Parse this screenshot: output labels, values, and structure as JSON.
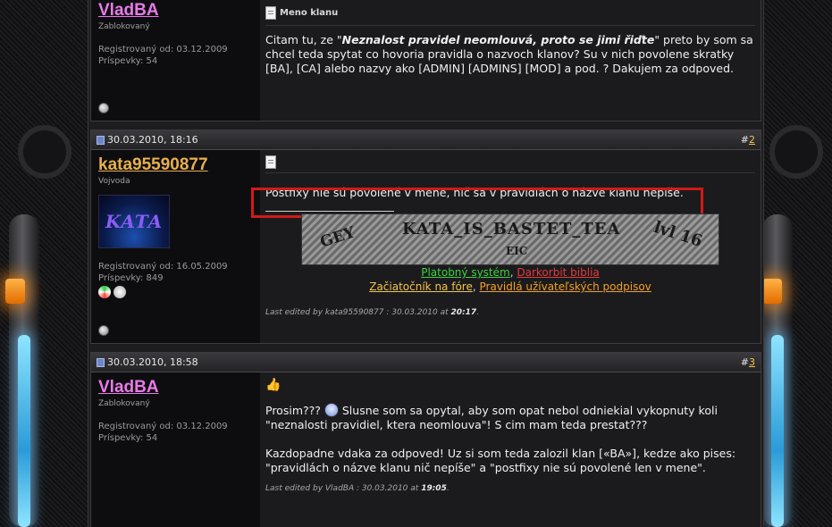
{
  "post1": {
    "username": "VladBA",
    "username_color": "#e87be8",
    "user_title": "Zablokovaný",
    "registered": "Registrovaný od: 03.12.2009",
    "posts": "Príspevky: 54",
    "msg_title": "Meno klanu",
    "text_before": "Citam tu, ze \"",
    "text_bold": "Neznalost pravidel neomlouvá, proto se jimi řiďte",
    "text_after": "\" preto by som sa chcel teda spytat co hovoria pravidla o nazvoch klanov? Su v nich povolene skratky [BA], [CA] alebo nazvy ako [ADMIN] [ADMINS] [MOD] a pod. ? Dakujem za odpoved."
  },
  "post2": {
    "date": "30.03.2010, 18:16",
    "num_hash": "#",
    "num": "2",
    "username": "kata95590877",
    "username_color": "#e8b04a",
    "user_title": "Vojvoda",
    "avatar_text": "KATA",
    "registered": "Registrovaný od: 16.05.2009",
    "posts": "Príspevky: 849",
    "text": "Postfixy nie sú povolené v mene, nič sa v pravidlách o názve klanu nepíše.",
    "banner": {
      "word1": "GEY",
      "word2": "KATA_IS_BASTET_TEA",
      "word3": "EIC",
      "word4": "lvl 16"
    },
    "sig_link1": "Platobný systém",
    "sig_link1_color": "#3fd13f",
    "sig_sep1": ",",
    "sig_link2": "Darkorbit biblia",
    "sig_link2_color": "#e23b3b",
    "sig_link3": "Začiatočník na fóre",
    "sig_link3_color": "#f2c447",
    "sig_sep2": ",",
    "sig_link4": "Pravidlá užívateľských podpisov",
    "sig_link4_color": "#f2a024",
    "edited_prefix": "Last edited by kata95590877 : 30.03.2010 at",
    "edited_time": "20:17",
    "edited_suffix": "."
  },
  "post3": {
    "date": "30.03.2010, 18:58",
    "num_hash": "#",
    "num": "3",
    "username": "VladBA",
    "username_color": "#e87be8",
    "user_title": "Zablokovaný",
    "registered": "Registrovaný od: 03.12.2009",
    "posts": "Príspevky: 54",
    "text1_a": "Prosim???",
    "text1_b": "Slusne som sa opytal, aby som opat nebol odniekial vykopnuty koli \"neznalosti pravidiel, ktera neomlouva\"! S cim mam teda prestat???",
    "text2": "Kazdopadne vdaka za odpoved! Uz si som teda zalozil klan [«BA»], kedze ako pises: \"pravidlách o názve klanu nič nepíše\" a \"postfixy nie sú povolené len v mene\".",
    "edited_prefix": "Last edited by VladBA : 30.03.2010 at",
    "edited_time": "19:05",
    "edited_suffix": "."
  }
}
